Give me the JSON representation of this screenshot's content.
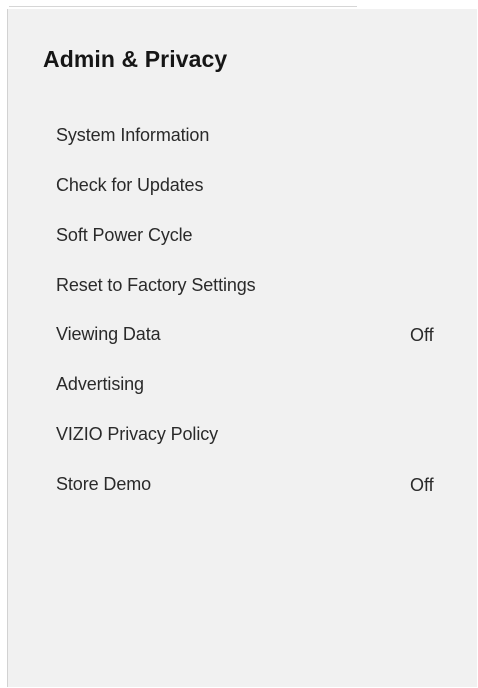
{
  "panel": {
    "title": "Admin & Privacy"
  },
  "menu": {
    "items": [
      {
        "label": "System Information",
        "value": ""
      },
      {
        "label": "Check for Updates",
        "value": ""
      },
      {
        "label": "Soft Power Cycle",
        "value": ""
      },
      {
        "label": "Reset to Factory Settings",
        "value": ""
      },
      {
        "label": "Viewing Data",
        "value": "Off"
      },
      {
        "label": "Advertising",
        "value": ""
      },
      {
        "label": "VIZIO Privacy Policy",
        "value": ""
      },
      {
        "label": "Store Demo",
        "value": "Off"
      }
    ]
  },
  "colors": {
    "panel_background": "#f1f1f1",
    "title_text": "#161616",
    "item_text": "#2a2a2a"
  }
}
